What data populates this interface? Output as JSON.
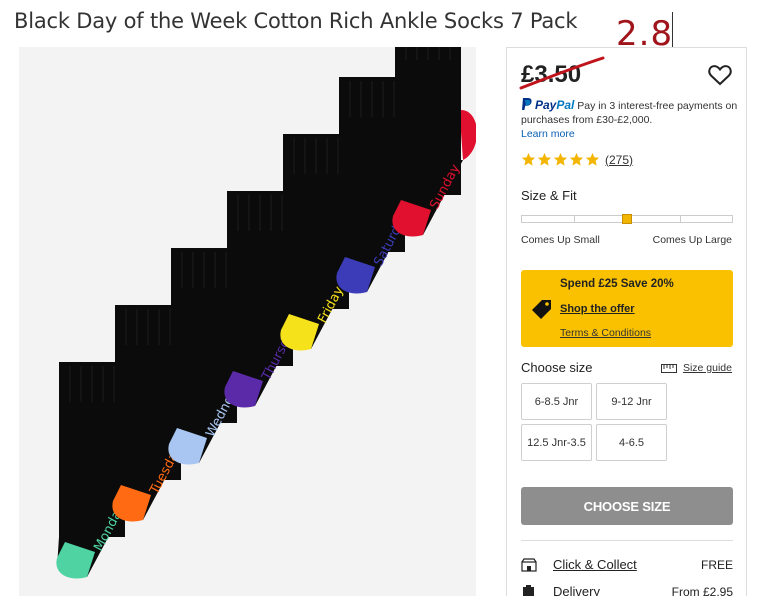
{
  "product": {
    "title": "Black Day of the Week Cotton Rich Ankle Socks 7 Pack",
    "image_alt": "Seven black ankle socks with coloured heels and toes, each labelled with a day of the week",
    "sock_days": [
      "Monday",
      "Tuesday",
      "Wednesday",
      "Thursday",
      "Friday",
      "Saturday",
      "Sunday"
    ],
    "sock_colors": [
      "#4fd3a2",
      "#ff6a12",
      "#a9c6f2",
      "#5a2aa8",
      "#f6e21a",
      "#3c3cb8",
      "#e0102e"
    ]
  },
  "annotation": {
    "text": "2.8"
  },
  "pricing": {
    "price": "£3.50"
  },
  "paypal": {
    "brand_pay": "Pay",
    "brand_pal": "Pal",
    "message": "Pay in 3 interest-free payments on purchases from £30-£2,000.",
    "learn_more": "Learn more"
  },
  "rating": {
    "stars": 5,
    "count": "(275)"
  },
  "fit": {
    "label": "Size & Fit",
    "value": 0.5,
    "small": "Comes Up Small",
    "large": "Comes Up Large"
  },
  "promo": {
    "title": "Spend £25 Save 20%",
    "link": "Shop the offer",
    "terms": "Terms & Conditions"
  },
  "sizes": {
    "label": "Choose size",
    "guide": "Size guide",
    "options": [
      "6-8.5 Jnr",
      "9-12 Jnr",
      "12.5 Jnr-3.5",
      "4-6.5"
    ]
  },
  "cta": {
    "label": "CHOOSE SIZE"
  },
  "delivery": [
    {
      "name": "Click & Collect",
      "value": "FREE"
    },
    {
      "name": "Delivery",
      "value": "From £2.95"
    }
  ],
  "colors": {
    "accent": "#f9c100",
    "annotation": "#a0141c",
    "cta": "#8e8e8e",
    "star": "#f3b600"
  }
}
